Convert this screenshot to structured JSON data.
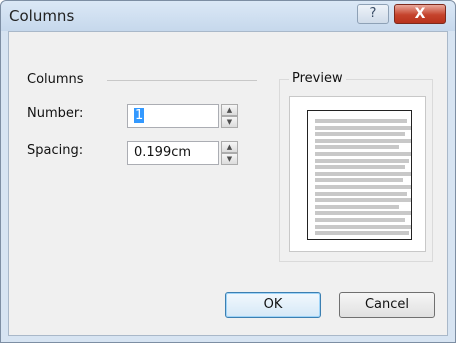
{
  "window": {
    "title": "Columns",
    "help_glyph": "?",
    "close_glyph": "X"
  },
  "columns_group": {
    "label": "Columns",
    "number": {
      "label": "Number:",
      "value": "1"
    },
    "spacing": {
      "label": "Spacing:",
      "value": "0.199cm"
    }
  },
  "preview": {
    "label": "Preview",
    "column_count": 1,
    "text_line_count": 18
  },
  "buttons": {
    "ok": "OK",
    "cancel": "Cancel"
  },
  "icons": {
    "help": "help-icon",
    "close": "close-icon",
    "spin_up": "spin-up-icon",
    "spin_down": "spin-down-icon"
  }
}
